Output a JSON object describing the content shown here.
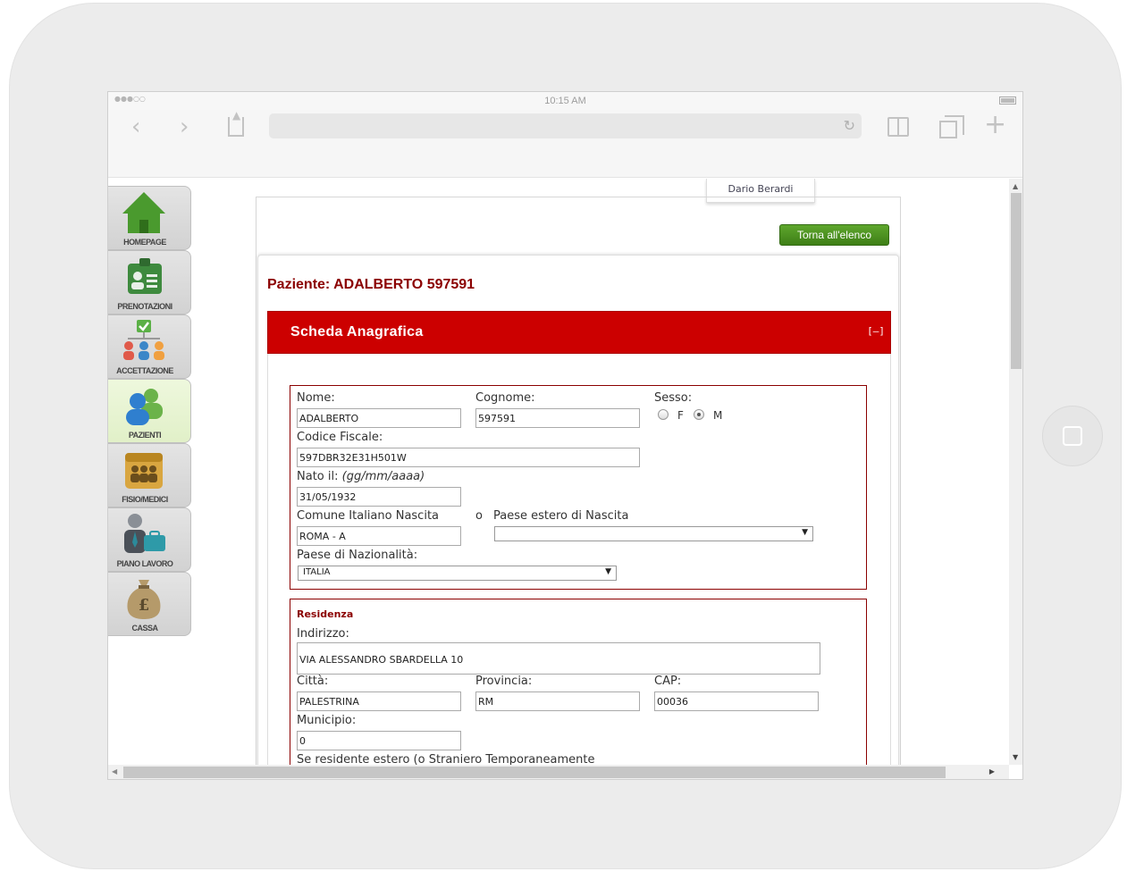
{
  "status_bar": {
    "signal": "●●●○○",
    "time": "10:15 AM"
  },
  "browser": {
    "back_glyph": "‹",
    "forward_glyph": "›",
    "reload_glyph": "↻",
    "new_tab_glyph": "+"
  },
  "sidebar": {
    "items": [
      {
        "label": "HOMEPAGE",
        "icon": "home-icon"
      },
      {
        "label": "PRENOTAZIONI",
        "icon": "appointments-icon"
      },
      {
        "label": "ACCETTAZIONE",
        "icon": "acceptance-icon"
      },
      {
        "label": "PAZIENTI",
        "icon": "patients-icon",
        "active": true
      },
      {
        "label": "FISIO/MEDICI",
        "icon": "doctors-icon"
      },
      {
        "label": "PIANO LAVORO",
        "icon": "work-plan-icon"
      },
      {
        "label": "CASSA",
        "icon": "money-bag-icon"
      }
    ]
  },
  "user": {
    "name": "Dario Berardi"
  },
  "actions": {
    "back_to_list": "Torna all'elenco"
  },
  "patient": {
    "title": "Paziente: ADALBERTO 597591"
  },
  "scheda": {
    "title": "Scheda Anagrafica",
    "collapse": "[–]"
  },
  "anagrafica": {
    "nome_label": "Nome:",
    "nome": "ADALBERTO",
    "cognome_label": "Cognome:",
    "cognome": "597591",
    "sesso_label": "Sesso:",
    "sesso_f": "F",
    "sesso_m": "M",
    "sesso_value": "M",
    "cf_label": "Codice Fiscale:",
    "cf": "597DBR32E31H501W",
    "nato_label": "Nato il:",
    "nato_hint": "(gg/mm/aaaa)",
    "nato": "31/05/1932",
    "comune_label": "Comune Italiano Nascita",
    "or_label": "o",
    "comune": "ROMA - A",
    "paese_estero_label": "Paese estero di Nascita",
    "paese_estero": "",
    "nazionalita_label": "Paese di Nazionalità:",
    "nazionalita": "ITALIA"
  },
  "residenza": {
    "title": "Residenza",
    "indirizzo_label": "Indirizzo:",
    "indirizzo": "VIA ALESSANDRO SBARDELLA 10",
    "citta_label": "Città:",
    "citta": "PALESTRINA",
    "provincia_label": "Provincia:",
    "provincia": "RM",
    "cap_label": "CAP:",
    "cap": "00036",
    "municipio_label": "Municipio:",
    "municipio": "0",
    "estero_label": "Se residente estero (o Straniero Temporaneamente"
  },
  "colors": {
    "accent_red": "#cc0000",
    "title_red": "#8b0000",
    "button_green": "#4e9522"
  }
}
